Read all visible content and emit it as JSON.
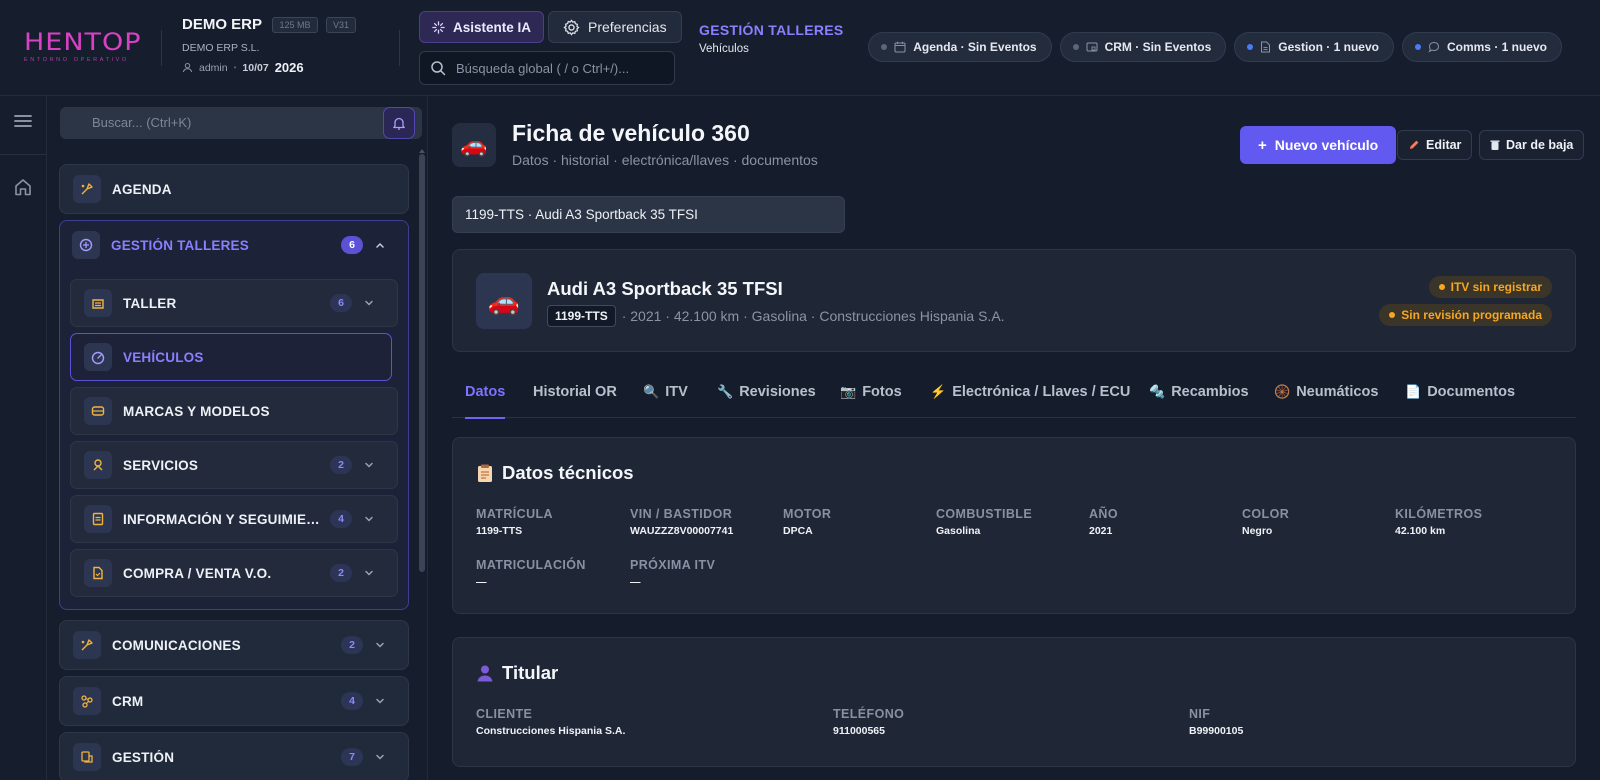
{
  "header": {
    "logo_text": "HENTOP",
    "logo_sub": "ENTORNO OPERATIVO",
    "company": "DEMO ERP",
    "badge_size": "125 MB",
    "badge_version": "V31",
    "company_sub": "DEMO ERP S.L.",
    "user": "admin",
    "date": "10/07",
    "year": "2026",
    "ai_button": "Asistente IA",
    "prefs_button": "Preferencias",
    "search_placeholder": "Búsqueda global ( / o Ctrl+/)...",
    "context_title": "GESTIÓN TALLERES",
    "context_sub": "Vehículos",
    "pills": [
      {
        "label": "Agenda · Sin Eventos",
        "icon": "calendar-icon",
        "dot": "#5c667a"
      },
      {
        "label": "CRM · Sin Eventos",
        "icon": "crm-icon",
        "dot": "#5c667a"
      },
      {
        "label": "Gestion · 1 nuevo",
        "icon": "document-icon",
        "dot": "#4a7cf5"
      },
      {
        "label": "Comms · 1 nuevo",
        "icon": "chat-icon",
        "dot": "#4a7cf5"
      }
    ]
  },
  "sidebar": {
    "search_placeholder": "Buscar... (Ctrl+K)",
    "agenda": "AGENDA",
    "group": {
      "label": "GESTIÓN TALLERES",
      "count": "6"
    },
    "sub_items": [
      {
        "label": "TALLER",
        "count": "6"
      },
      {
        "label": "VEHÍCULOS"
      },
      {
        "label": "MARCAS Y MODELOS"
      },
      {
        "label": "SERVICIOS",
        "count": "2"
      },
      {
        "label": "INFORMACIÓN Y SEGUIMIENTO",
        "count": "4"
      },
      {
        "label": "COMPRA / VENTA V.O.",
        "count": "2"
      }
    ],
    "items": [
      {
        "label": "COMUNICACIONES",
        "count": "2"
      },
      {
        "label": "CRM",
        "count": "4"
      },
      {
        "label": "GESTIÓN",
        "count": "7"
      }
    ]
  },
  "page": {
    "title": "Ficha de vehículo 360",
    "subtitle": "Datos · historial · electrónica/llaves · documentos",
    "new_button": "Nuevo vehículo",
    "edit_button": "Editar",
    "deregister_button": "Dar de baja",
    "vehicle_select": "1199-TTS · Audi A3 Sportback 35 TFSI"
  },
  "vehicle": {
    "name": "Audi A3 Sportback 35 TFSI",
    "plate": "1199-TTS",
    "meta": "· 2021 · 42.100 km · Gasolina · Construcciones Hispania S.A.",
    "badge_itv": "ITV sin registrar",
    "badge_revision": "Sin revisión programada"
  },
  "tabs": [
    {
      "label": "Datos",
      "icon": ""
    },
    {
      "label": "Historial OR",
      "icon": ""
    },
    {
      "label": "ITV",
      "icon": "🔍"
    },
    {
      "label": "Revisiones",
      "icon": "🔧"
    },
    {
      "label": "Fotos",
      "icon": "📷"
    },
    {
      "label": "Electrónica / Llaves / ECU",
      "icon": "⚡"
    },
    {
      "label": "Recambios",
      "icon": "🔩"
    },
    {
      "label": "Neumáticos",
      "icon": "🛞"
    },
    {
      "label": "Documentos",
      "icon": "📄"
    }
  ],
  "technical": {
    "title": "Datos técnicos",
    "fields": [
      {
        "label": "MATRÍCULA",
        "value": "1199-TTS"
      },
      {
        "label": "VIN / BASTIDOR",
        "value": "WAUZZZ8V00007741"
      },
      {
        "label": "MOTOR",
        "value": "DPCA"
      },
      {
        "label": "COMBUSTIBLE",
        "value": "Gasolina"
      },
      {
        "label": "AÑO",
        "value": "2021"
      },
      {
        "label": "COLOR",
        "value": "Negro"
      },
      {
        "label": "KILÓMETROS",
        "value": "42.100 km"
      },
      {
        "label": "MATRICULACIÓN",
        "value": "—"
      },
      {
        "label": "PRÓXIMA ITV",
        "value": "—"
      }
    ]
  },
  "owner": {
    "title": "Titular",
    "fields": [
      {
        "label": "CLIENTE",
        "value": "Construcciones Hispania S.A."
      },
      {
        "label": "TELÉFONO",
        "value": "911000565"
      },
      {
        "label": "NIF",
        "value": "B99900105"
      }
    ]
  },
  "colors": {
    "accent": "#6259f0",
    "accent_text": "#8a80ff",
    "logo": "#d941c4",
    "warning": "#f5a623"
  }
}
